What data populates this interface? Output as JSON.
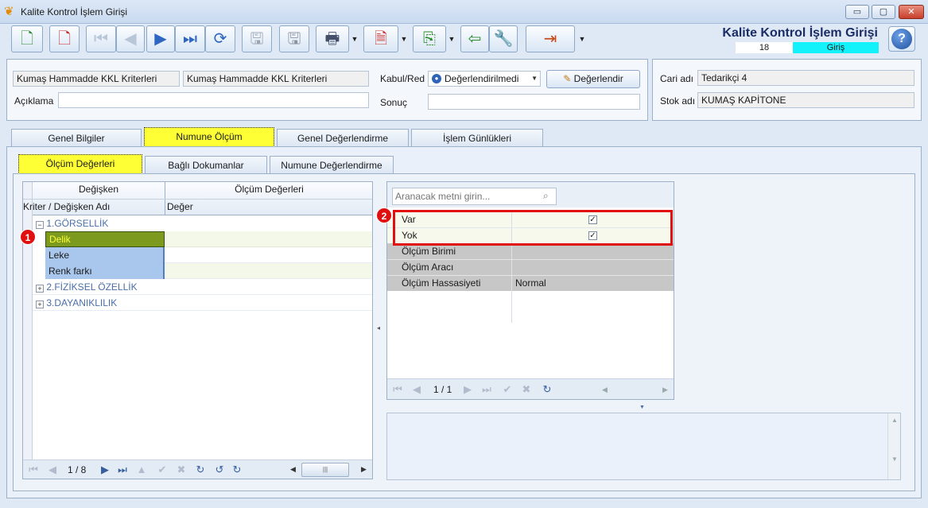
{
  "window": {
    "title": "Kalite Kontrol İşlem Girişi",
    "controls": {
      "minimize": "▭",
      "maximize": "▢",
      "close": "✕"
    }
  },
  "header": {
    "title": "Kalite Kontrol İşlem Girişi",
    "record_no": "18",
    "mode": "Giriş",
    "help": "?"
  },
  "form": {
    "criteria_code": "Kumaş Hammadde KKL Kriterleri",
    "criteria_name": "Kumaş Hammadde KKL Kriterleri",
    "description_label": "Açıklama",
    "description_value": "",
    "accept_label": "Kabul/Red",
    "accept_value": "Değerlendirilmedi",
    "evaluate_button": "Değerlendir",
    "result_label": "Sonuç",
    "result_value": ""
  },
  "side": {
    "account_label": "Cari adı",
    "account_value": "Tedarikçi 4",
    "stock_label": "Stok adı",
    "stock_value": "KUMAŞ KAPİTONE"
  },
  "tabs": [
    "Genel Bilgiler",
    "Numune Ölçüm",
    "Genel Değerlendirme",
    "İşlem Günlükleri"
  ],
  "subtabs": [
    "Ölçüm Değerleri",
    "Bağlı Dokumanlar",
    "Numune Değerlendirme"
  ],
  "grid": {
    "band_left": "Değişken",
    "band_right": "Ölçüm Değerleri",
    "col_name": "Kriter / Değişken Adı",
    "col_value": "Değer",
    "groups": [
      {
        "label": "1.GÖRSELLİK",
        "expand": "−",
        "rows": [
          "Delik",
          "Leke",
          "Renk farkı"
        ]
      },
      {
        "label": "2.FİZİKSEL ÖZELLİK",
        "expand": "+"
      },
      {
        "label": "3.DAYANIKLILIK",
        "expand": "+"
      }
    ],
    "pager": "1 / 8"
  },
  "props": {
    "search_placeholder": "Aranacak metni girin...",
    "rows": [
      {
        "name": "Var",
        "value": ""
      },
      {
        "name": "Yok",
        "value": ""
      },
      {
        "name": "Ölçüm Birimi",
        "value": ""
      },
      {
        "name": "Ölçüm Aracı",
        "value": ""
      },
      {
        "name": "Ölçüm Hassasiyeti",
        "value": "Normal"
      }
    ],
    "pager": "1 / 1"
  },
  "callouts": [
    "1",
    "2"
  ],
  "colors": {
    "accent_yellow": "#ffff35",
    "mode_cyan": "#13f2fb",
    "selected_row": "#7c9a1e",
    "group_text": "#4a6ea8",
    "callout": "#e01010"
  }
}
